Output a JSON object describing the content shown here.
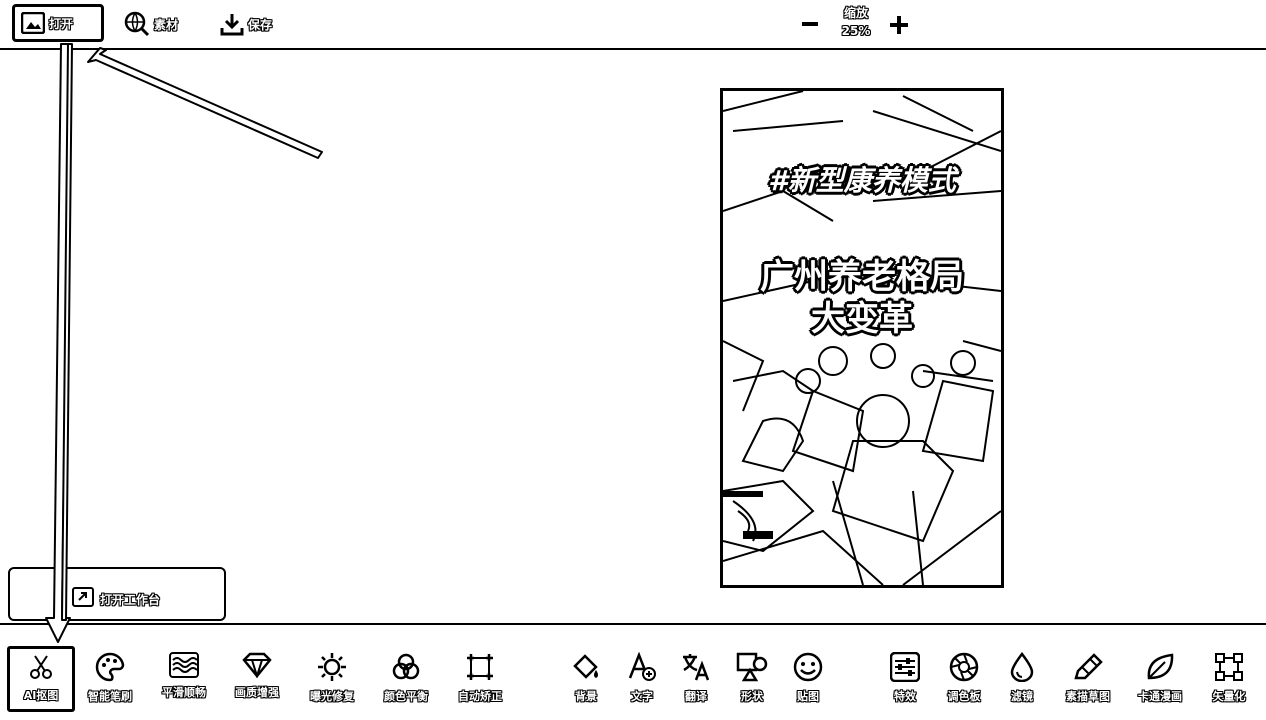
{
  "toolbar": {
    "open_label": "打开",
    "material_label": "素材",
    "save_label": "保存",
    "zoom_label": "缩放",
    "zoom_value": "25%"
  },
  "poster": {
    "hashtag": "#新型康养模式",
    "headline_1": "广州养老格局",
    "headline_2": "大变革"
  },
  "workbench": {
    "open_label": "打开工作台"
  },
  "tools": [
    {
      "label": "AI抠图",
      "icon": "scissors-icon"
    },
    {
      "label": "智能笔刷",
      "icon": "palette-icon"
    },
    {
      "label": "平滑顺畅",
      "icon": "waves-icon"
    },
    {
      "label": "画质增强",
      "icon": "diamond-icon"
    },
    {
      "label": "曝光修复",
      "icon": "sun-icon"
    },
    {
      "label": "颜色平衡",
      "icon": "color-circles-icon"
    },
    {
      "label": "自动矫正",
      "icon": "crop-icon"
    },
    {
      "label": "背景",
      "icon": "paint-bucket-icon"
    },
    {
      "label": "文字",
      "icon": "text-add-icon"
    },
    {
      "label": "翻译",
      "icon": "translate-icon"
    },
    {
      "label": "形状",
      "icon": "shapes-icon"
    },
    {
      "label": "贴图",
      "icon": "sticker-icon"
    },
    {
      "label": "特效",
      "icon": "sliders-icon"
    },
    {
      "label": "调色板",
      "icon": "aperture-icon"
    },
    {
      "label": "滤镜",
      "icon": "drop-icon"
    },
    {
      "label": "素描草图",
      "icon": "pencil-icon"
    },
    {
      "label": "卡通漫画",
      "icon": "leaf-icon"
    },
    {
      "label": "矢量化",
      "icon": "vector-icon"
    }
  ]
}
